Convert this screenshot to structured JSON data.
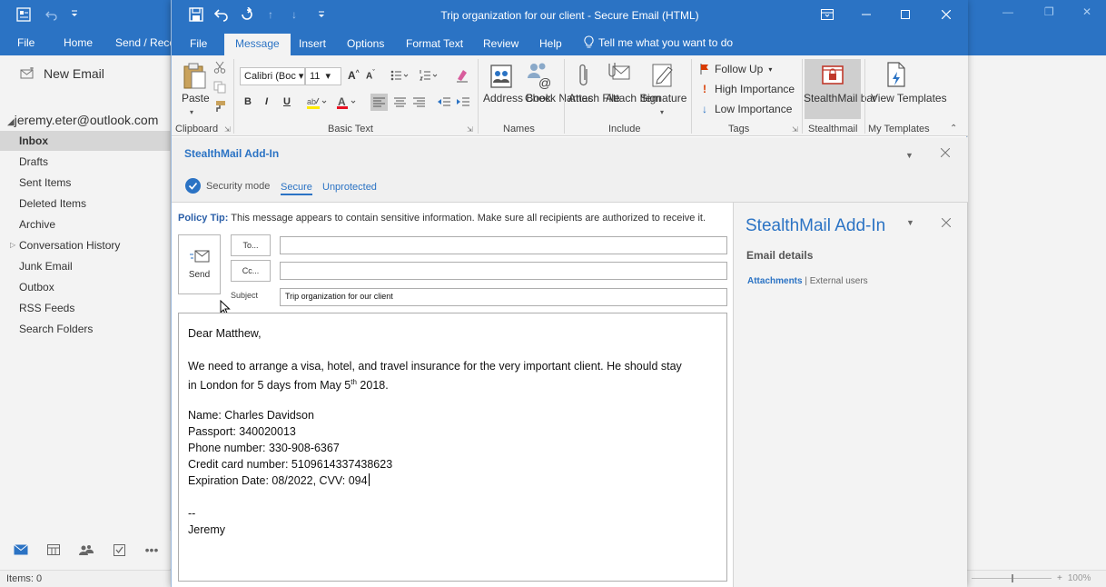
{
  "background": {
    "tabs": [
      "File",
      "Home",
      "Send / Recei"
    ],
    "new_email": "New Email",
    "account": "jeremy.eter@outlook.com",
    "folders": [
      "Inbox",
      "Drafts",
      "Sent Items",
      "Deleted Items",
      "Archive",
      "Conversation History",
      "Junk Email",
      "Outbox",
      "RSS Feeds",
      "Search Folders"
    ],
    "selected_folder": "Inbox",
    "status_items": "Items: 0",
    "zoom": "100%"
  },
  "window": {
    "title": "Trip organization for our client  -  Secure Email (HTML)",
    "tabs": [
      "File",
      "Message",
      "Insert",
      "Options",
      "Format Text",
      "Review",
      "Help"
    ],
    "active_tab": "Message",
    "tell_me": "Tell me what you want to do"
  },
  "ribbon": {
    "clipboard": {
      "paste": "Paste",
      "label": "Clipboard"
    },
    "basic_text": {
      "font": "Calibri (Boc",
      "size": "11",
      "bold": "B",
      "italic": "I",
      "underline": "U",
      "label": "Basic Text"
    },
    "names": {
      "address_book": "Address Book",
      "check_names": "Check Names",
      "label": "Names"
    },
    "include": {
      "attach_file": "Attach File",
      "attach_item": "Attach Item",
      "signature": "Signature",
      "label": "Include"
    },
    "tags": {
      "follow_up": "Follow Up",
      "high": "High Importance",
      "low": "Low Importance",
      "label": "Tags"
    },
    "stealthmail": {
      "button": "StealthMail bar",
      "label": "Stealthmail"
    },
    "templates": {
      "button": "View Templates",
      "label": "My Templates"
    }
  },
  "addin_bar": {
    "title": "StealthMail Add-In",
    "security_mode": "Security mode",
    "mode_secure": "Secure",
    "mode_unprotected": "Unprotected"
  },
  "compose": {
    "policy_label": "Policy Tip:",
    "policy_text": " This message appears to contain sensitive information. Make sure all recipients are authorized to receive it.",
    "send": "Send",
    "to": "To...",
    "cc": "Cc...",
    "subject_label": "Subject",
    "to_value": "",
    "cc_value": "",
    "subject_value": "Trip organization for our client",
    "body": {
      "greeting": "Dear Matthew,",
      "line1": "We need to arrange a visa, hotel, and travel insurance for the very important client. He should stay",
      "line2a": "in London for 5 days from May 5",
      "line2sup": "th",
      "line2b": " 2018.",
      "name": "Name: Charles Davidson",
      "passport": "Passport: 340020013",
      "phone": "Phone number: 330-908-6367",
      "card": "Credit card number: 5109614337438623",
      "exp": "Expiration Date: 08/2022, CVV: 094",
      "sig_sep": "--",
      "sig_name": "Jeremy"
    }
  },
  "side_pane": {
    "title": "StealthMail Add-In",
    "subtitle": "Email details",
    "link_attachments": "Attachments",
    "link_sep": " | ",
    "link_external": "External users"
  },
  "colors": {
    "accent": "#2b73c4",
    "ribbon_bg": "#f3f3f3",
    "stealth_selected": "#cfcfcf",
    "high_importance": "#d83b01"
  }
}
